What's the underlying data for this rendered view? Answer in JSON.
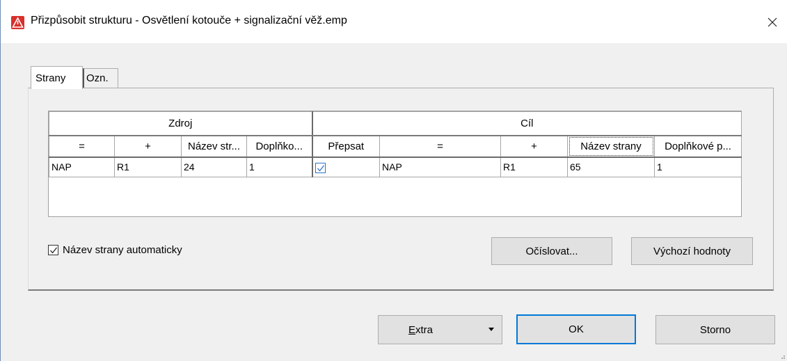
{
  "window": {
    "title": "Přizpůsobit strukturu - Osvětlení kotouče + signalizační věž.emp",
    "close_symbol": "✕",
    "icon": "eplan-app-icon"
  },
  "tabs": [
    {
      "label": "Strany",
      "active": true
    },
    {
      "label": "Ozn.",
      "active": false
    }
  ],
  "grid": {
    "groups": {
      "source": "Zdroj",
      "target": "Cíl"
    },
    "headers": [
      "=",
      "+",
      "Název str...",
      "Doplňko...",
      "Přepsat",
      "=",
      "+",
      "Název strany",
      "Doplňkové p..."
    ],
    "rows": [
      {
        "src_eq": "NAP",
        "src_plus": "R1",
        "src_name": "24",
        "src_extra": "1",
        "overwrite": true,
        "dst_eq": "NAP",
        "dst_plus": "R1",
        "dst_name": "65",
        "dst_extra": "1"
      }
    ]
  },
  "auto_name": {
    "label": "Název strany automaticky",
    "checked": true
  },
  "buttons": {
    "ocislovat": "Očíslovat...",
    "vychozi": "Výchozí hodnoty",
    "extra_accel": "E",
    "extra_rest": "xtra",
    "ok": "OK",
    "storno": "Storno"
  },
  "colors": {
    "accent": "#0078d7",
    "checkbox_blue": "#2a74c7",
    "icon_red": "#d9302c"
  }
}
